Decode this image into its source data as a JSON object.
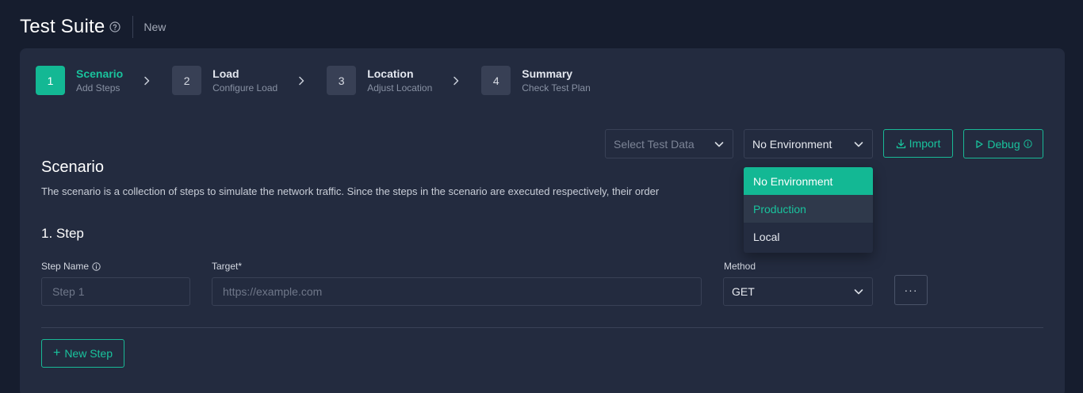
{
  "header": {
    "title": "Test Suite",
    "subtitle": "New"
  },
  "steps": [
    {
      "number": "1",
      "title": "Scenario",
      "subtitle": "Add Steps",
      "active": true
    },
    {
      "number": "2",
      "title": "Load",
      "subtitle": "Configure Load",
      "active": false
    },
    {
      "number": "3",
      "title": "Location",
      "subtitle": "Adjust Location",
      "active": false
    },
    {
      "number": "4",
      "title": "Summary",
      "subtitle": "Check Test Plan",
      "active": false
    }
  ],
  "toolbar": {
    "test_data_placeholder": "Select Test Data",
    "environment_value": "No Environment",
    "import_label": "Import",
    "debug_label": "Debug"
  },
  "environment_dropdown": {
    "options": [
      "No Environment",
      "Production",
      "Local"
    ],
    "selected": "No Environment",
    "highlighted": "Production"
  },
  "scenario": {
    "title": "Scenario",
    "description": "The scenario is a collection of steps to simulate the network traffic. Since the steps in the scenario are executed respectively, their order"
  },
  "step_form": {
    "heading": "1. Step",
    "step_name_label": "Step Name",
    "step_name_placeholder": "Step 1",
    "target_label": "Target*",
    "target_placeholder": "https://example.com",
    "method_label": "Method",
    "method_value": "GET",
    "more_label": "···"
  },
  "actions": {
    "new_step_label": "New Step"
  },
  "colors": {
    "accent": "#13b894",
    "background": "#161d2e",
    "card": "#232b3f"
  }
}
